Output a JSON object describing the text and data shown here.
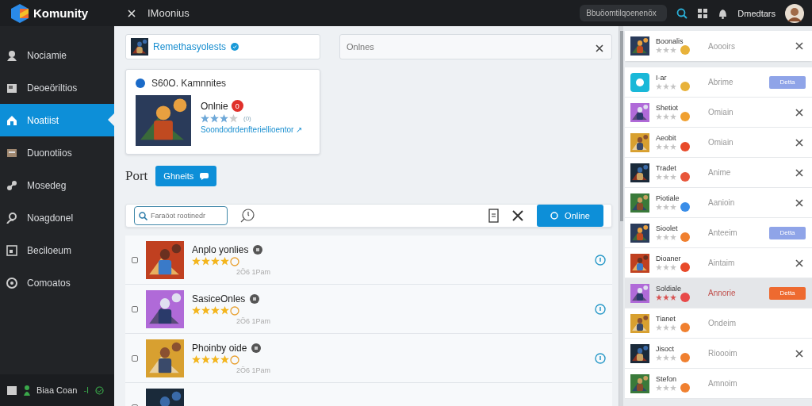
{
  "app": {
    "logo": "Komunity"
  },
  "topbar": {
    "title": "IMoonius",
    "search": {
      "placeholder": "Bbuöomtilqoenenöx"
    },
    "user": "Dmedtars"
  },
  "sidebar": {
    "items": [
      {
        "label": "Nociamie",
        "selected": false
      },
      {
        "label": "Deoeöriltios",
        "selected": false
      },
      {
        "label": "Noatiist",
        "selected": true
      },
      {
        "label": "Duonotiios",
        "selected": false
      },
      {
        "label": "Mosedeg",
        "selected": false
      },
      {
        "label": "Noagdonel",
        "selected": false
      },
      {
        "label": "Beciloeum",
        "selected": false
      },
      {
        "label": "Comoatos",
        "selected": false
      }
    ],
    "footer": {
      "user": "Biaa Coan",
      "status": "-I"
    }
  },
  "profile": {
    "name": "Remethasyolests",
    "verified": true
  },
  "filter": {
    "placeholder": "Onlnes"
  },
  "feature": {
    "header": "S60O. Kamnnites",
    "title": "Onlnie",
    "badge": "0",
    "stars": 3,
    "count": "(0)",
    "link": "Soondodrdenfteriellioentor ↗"
  },
  "section": {
    "title": "Port",
    "button": "Ghneits"
  },
  "toolbar": {
    "search": {
      "placeholder": "Faraöot rootinedr"
    },
    "button": "Online"
  },
  "games": [
    {
      "title": "Anplo yonlies",
      "stars": 4,
      "time": "2Ö6 1Pam",
      "checked": false
    },
    {
      "title": "SasiceOnles",
      "stars": 4,
      "time": "2Ö6 1Pam",
      "checked": false
    },
    {
      "title": "Phoinby oide",
      "stars": 4,
      "time": "2Ö6 1Pam",
      "checked": false
    }
  ],
  "friends": [
    {
      "name": "Boonalis",
      "status": "Aoooirs",
      "kind": "close",
      "color": "#e8b23a",
      "selected": false,
      "separate": true
    },
    {
      "name": "I·ar",
      "status": "Abrime",
      "kind": "button",
      "button": "Detta",
      "color": "#e8b23a",
      "selected": false
    },
    {
      "name": "Shetiot",
      "status": "Omiain",
      "kind": "close",
      "color": "#f0a030",
      "selected": false
    },
    {
      "name": "Aeobit",
      "status": "Omiain",
      "kind": "close",
      "color": "#e84a2a",
      "selected": false
    },
    {
      "name": "Tradet",
      "status": "Anime",
      "kind": "close",
      "color": "#e8563a",
      "selected": false
    },
    {
      "name": "Piotiale",
      "status": "Aanioin",
      "kind": "close",
      "color": "#3a8ee8",
      "selected": false
    },
    {
      "name": "Sioolet",
      "status": "Anteeim",
      "kind": "button",
      "button": "Detta",
      "color": "#f08030",
      "selected": false
    },
    {
      "name": "Dioaner",
      "status": "Aintaim",
      "kind": "close",
      "color": "#e84a2a",
      "selected": false
    },
    {
      "name": "Soldiale",
      "status": "Annorie",
      "kind": "button",
      "button": "Detta",
      "color": "#e84a4a",
      "selected": true
    },
    {
      "name": "Tianet",
      "status": "Ondeim",
      "kind": "plain",
      "color": "#f08030",
      "selected": false
    },
    {
      "name": "Jisoct",
      "status": "Rioooim",
      "kind": "close",
      "color": "#f08030",
      "selected": false
    },
    {
      "name": "Stefon",
      "status": "Amnoim",
      "kind": "plain",
      "color": "#f08030",
      "selected": false
    }
  ]
}
